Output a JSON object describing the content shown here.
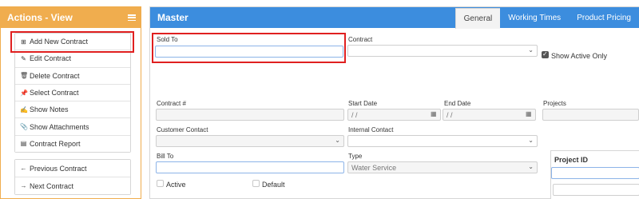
{
  "actions": {
    "title": "Actions - View",
    "group1": [
      {
        "label": "Add New Contract",
        "icon": "plus-square-icon",
        "glyph": "⊞"
      },
      {
        "label": "Edit Contract",
        "icon": "edit-icon",
        "glyph": "✎"
      },
      {
        "label": "Delete Contract",
        "icon": "trash-icon",
        "glyph": "🗑"
      },
      {
        "label": "Select Contract",
        "icon": "pin-icon",
        "glyph": "📌"
      },
      {
        "label": "Show Notes",
        "icon": "notes-icon",
        "glyph": "✍"
      },
      {
        "label": "Show Attachments",
        "icon": "paperclip-icon",
        "glyph": "📎"
      },
      {
        "label": "Contract Report",
        "icon": "file-icon",
        "glyph": "▤"
      }
    ],
    "group2": [
      {
        "label": "Previous Contract",
        "icon": "arrow-left-icon",
        "glyph": "←"
      },
      {
        "label": "Next Contract",
        "icon": "arrow-right-icon",
        "glyph": "→"
      }
    ]
  },
  "main": {
    "title": "Master",
    "tabs": [
      "General",
      "Working Times",
      "Product Pricing"
    ],
    "active_tab": "General"
  },
  "form": {
    "sold_to": {
      "label": "Sold To",
      "value": ""
    },
    "contract": {
      "label": "Contract",
      "value": ""
    },
    "show_active_only": {
      "label": "Show Active Only",
      "checked": true
    },
    "contract_no": {
      "label": "Contract #",
      "value": ""
    },
    "start_date": {
      "label": "Start Date",
      "value": " / /"
    },
    "end_date": {
      "label": "End Date",
      "value": " / /"
    },
    "projects": {
      "label": "Projects",
      "value": ""
    },
    "customer_contact": {
      "label": "Customer Contact",
      "value": ""
    },
    "internal_contact": {
      "label": "Internal Contact",
      "value": ""
    },
    "bill_to": {
      "label": "Bill To",
      "value": ""
    },
    "type": {
      "label": "Type",
      "value": "Water Service"
    },
    "active": {
      "label": "Active",
      "checked": false
    },
    "default": {
      "label": "Default",
      "checked": false
    },
    "project_id": {
      "label": "Project ID"
    }
  },
  "colors": {
    "actions_header": "#f0ad4e",
    "main_header": "#3c8dde",
    "highlight": "#e02020"
  }
}
